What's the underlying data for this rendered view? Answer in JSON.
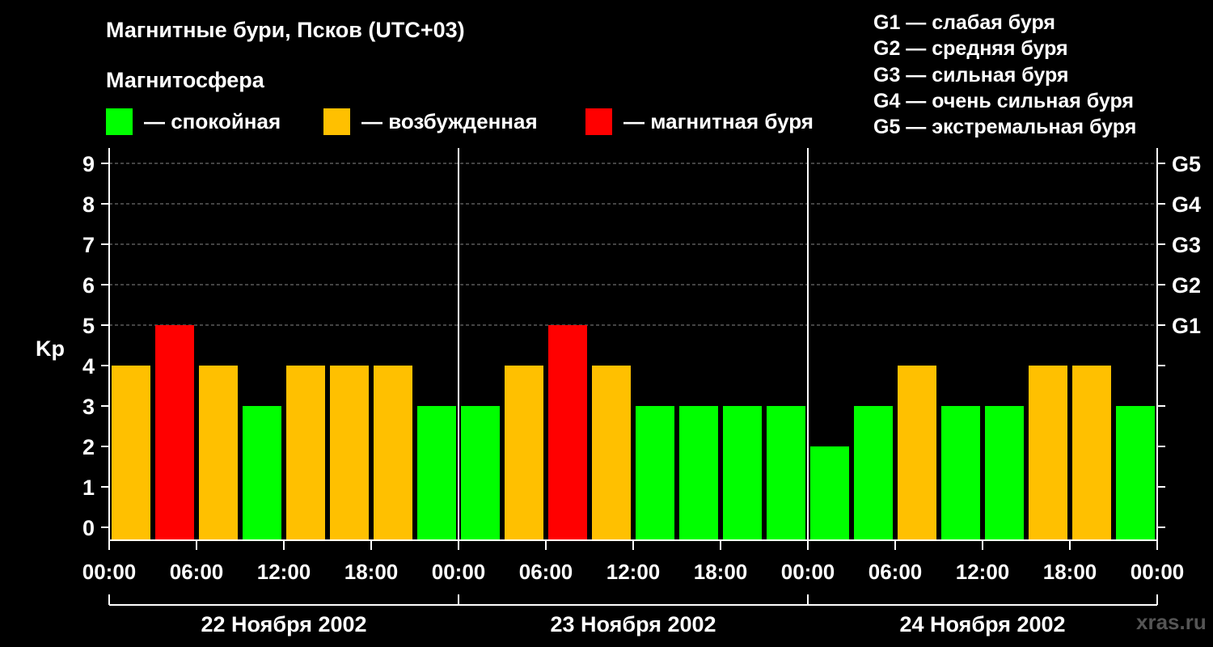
{
  "title": "Магнитные бури, Псков (UTC+03)",
  "subtitle": "Магнитосфера",
  "legend": [
    {
      "label": "— спокойная",
      "color": "#00ff00"
    },
    {
      "label": "— возбужденная",
      "color": "#ffc000"
    },
    {
      "label": "— магнитная буря",
      "color": "#ff0000"
    }
  ],
  "storm_legend": [
    "G1 — слабая буря",
    "G2 — средняя буря",
    "G3 — сильная буря",
    "G4 — очень сильная буря",
    "G5 — экстремальная буря"
  ],
  "watermark": "xras.ru",
  "chart_data": {
    "type": "bar",
    "ylabel": "Kp",
    "ylim": [
      0,
      9
    ],
    "y_ticks": [
      0,
      1,
      2,
      3,
      4,
      5,
      6,
      7,
      8,
      9
    ],
    "right_axis_labels": [
      {
        "kp": 5,
        "label": "G1"
      },
      {
        "kp": 6,
        "label": "G2"
      },
      {
        "kp": 7,
        "label": "G3"
      },
      {
        "kp": 8,
        "label": "G4"
      },
      {
        "kp": 9,
        "label": "G5"
      }
    ],
    "x_tick_labels": [
      "00:00",
      "06:00",
      "12:00",
      "18:00",
      "00:00",
      "06:00",
      "12:00",
      "18:00",
      "00:00",
      "06:00",
      "12:00",
      "18:00",
      "00:00"
    ],
    "days": [
      "22 Ноября 2002",
      "23 Ноября 2002",
      "24 Ноября 2002"
    ],
    "values": [
      4,
      5,
      4,
      3,
      4,
      4,
      4,
      3,
      3,
      4,
      5,
      4,
      3,
      3,
      3,
      3,
      2,
      3,
      4,
      3,
      3,
      4,
      4,
      3
    ],
    "colors": {
      "quiet": "#00ff00",
      "active": "#ffc000",
      "storm": "#ff0000"
    },
    "grid": true
  }
}
